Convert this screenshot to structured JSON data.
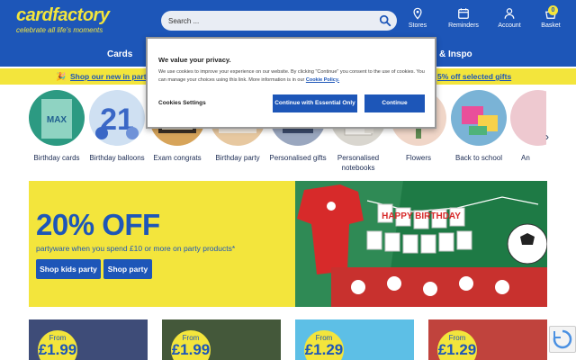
{
  "header": {
    "brand": "cardfactory",
    "tagline": "celebrate all life's moments",
    "search_placeholder": "Search ...",
    "icons": [
      {
        "label": "Stores",
        "icon": "pin-icon"
      },
      {
        "label": "Reminders",
        "icon": "calendar-icon"
      },
      {
        "label": "Account",
        "icon": "user-icon"
      },
      {
        "label": "Basket",
        "icon": "basket-icon"
      }
    ],
    "basket_count": "0"
  },
  "catnav": {
    "items": [
      "Cards",
      "& Inspo"
    ]
  },
  "strip": {
    "left": "Shop our new in party",
    "right": "5% off selected gifts"
  },
  "categories": [
    {
      "label": "Birthday cards",
      "color": "#2c9a82"
    },
    {
      "label": "Birthday balloons",
      "color": "#3a67c6"
    },
    {
      "label": "Exam congrats",
      "color": "#d7a45a"
    },
    {
      "label": "Birthday party",
      "color": "#e7c8a0"
    },
    {
      "label": "Personalised gifts",
      "color": "#6b7fa6"
    },
    {
      "label": "Personalised notebooks",
      "color": "#d9d6cf"
    },
    {
      "label": "Flowers",
      "color": "#e29a77"
    },
    {
      "label": "Back to school",
      "color": "#7ab3d6"
    },
    {
      "label": "An",
      "color": "#eec9d0"
    }
  ],
  "hero": {
    "headline": "20% OFF",
    "subtext": "partyware when you spend £10 or more on party products*",
    "btn1": "Shop kids party",
    "btn2": "Shop party",
    "banner_text": "HAPPY BIRTHDAY"
  },
  "tiles": [
    {
      "from": "From",
      "price": "£1.99",
      "color": "#3e4c78"
    },
    {
      "from": "From",
      "price": "£1.99",
      "color": "#44583a"
    },
    {
      "from": "From",
      "price": "£1.29",
      "color": "#5dbfe6"
    },
    {
      "from": "From",
      "price": "£1.29",
      "color": "#c0433d"
    }
  ],
  "cookie": {
    "title": "We value your privacy.",
    "body": "We use cookies to improve your experience on our website. By clicking \"Continue\" you consent to the use of cookies. You can manage your choices using this link. More information is in our",
    "policy_link": "Cookie Policy.",
    "settings": "Cookies Settings",
    "essential": "Continue with Essential Only",
    "continue": "Continue"
  },
  "colors": {
    "brand_blue": "#1d56b8",
    "brand_yellow": "#f3e53c"
  }
}
